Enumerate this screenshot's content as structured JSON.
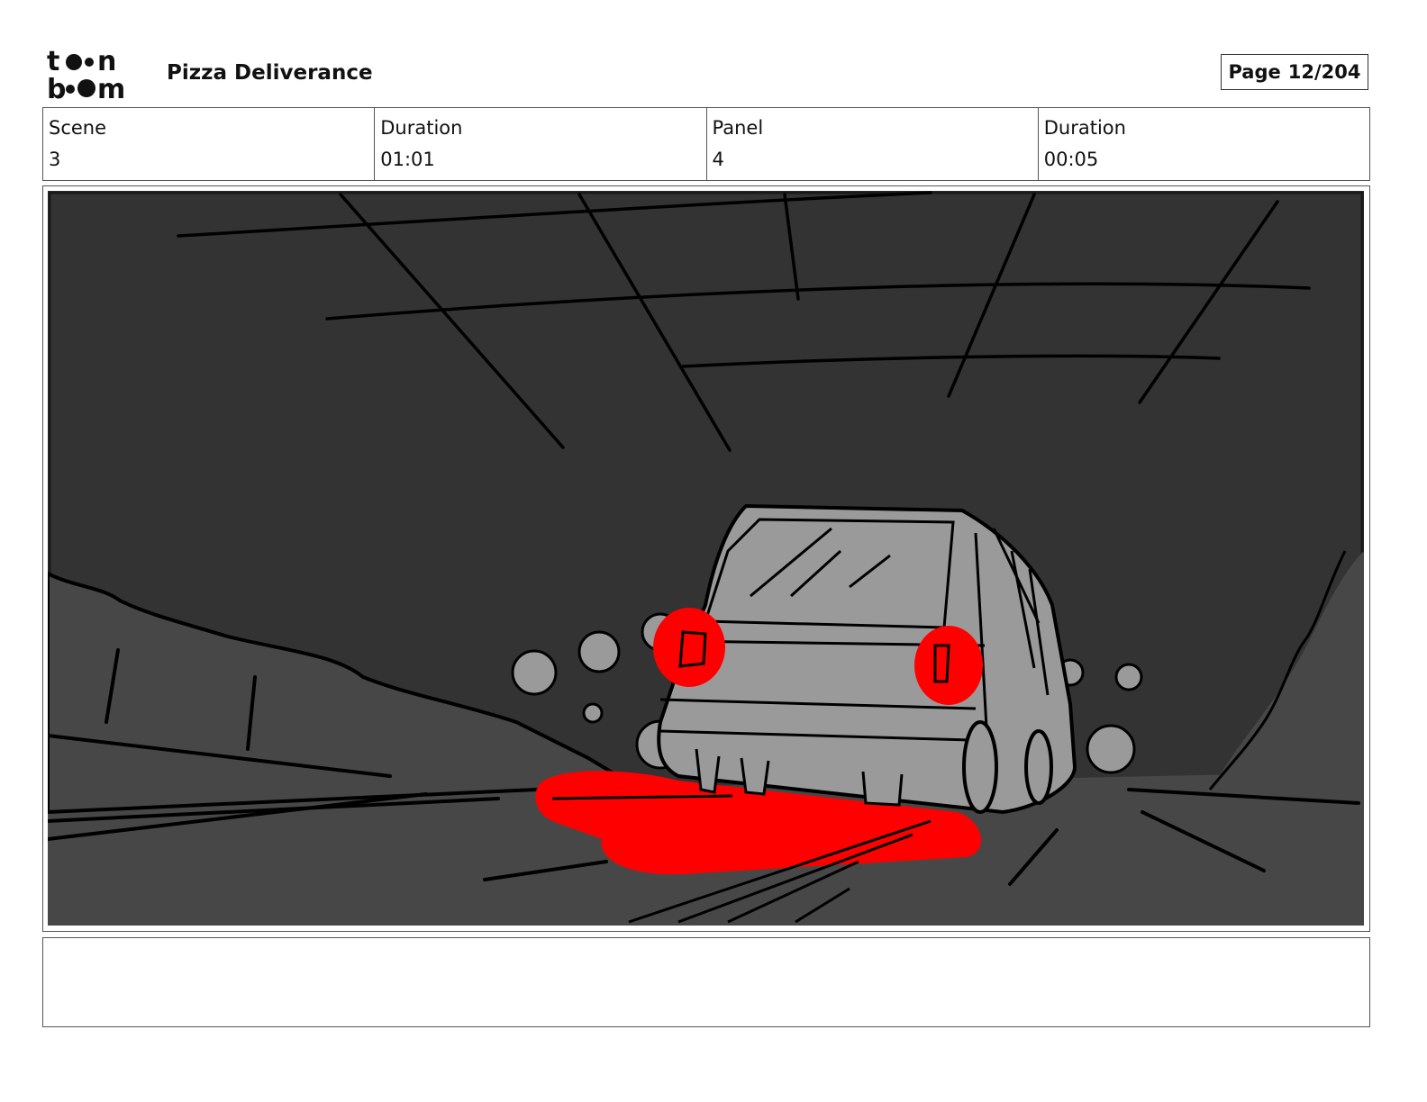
{
  "header": {
    "logo": "toon boom",
    "project_title": "Pizza Deliverance",
    "page_label": "Page",
    "page_number": "12/204"
  },
  "info": {
    "scene_label": "Scene",
    "scene_value": "3",
    "scene_duration_label": "Duration",
    "scene_duration_value": "01:01",
    "panel_label": "Panel",
    "panel_value": "4",
    "panel_duration_label": "Duration",
    "panel_duration_value": "00:05"
  },
  "panel": {
    "colors": {
      "background": "#333333",
      "road": "#474747",
      "car_body": "#9a9a9a",
      "tail_light": "#ff0000",
      "ink": "#000000"
    }
  },
  "notes": {
    "text": ""
  }
}
